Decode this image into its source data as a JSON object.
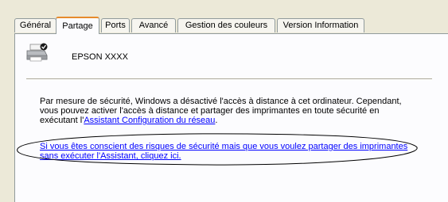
{
  "tabs": [
    {
      "label": "Général"
    },
    {
      "label": "Partage",
      "active": true
    },
    {
      "label": "Ports"
    },
    {
      "label": "Avancé"
    },
    {
      "label": "Gestion des couleurs"
    },
    {
      "label": "Version Information"
    }
  ],
  "printer": {
    "icon": "shared-printer-icon",
    "name": "EPSON XXXX"
  },
  "message": {
    "text": "Par mesure de sécurité, Windows a désactivé l'accès à distance à cet ordinateur. Cependant, vous pouvez activer l'accès à distance et partager des imprimantes en toute sécurité en exécutant l'",
    "link": "Assistant Configuration du réseau",
    "suffix": "."
  },
  "share_link": "Si vous êtes conscient des risques de sécurité mais que vous voulez partager des imprimantes sans exécuter l'Assistant, cliquez ici.",
  "colors": {
    "link": "#0000ff",
    "tab_border": "#919b9c",
    "active_tab_accent": "#e68b2c",
    "dialog_background": "#ece9d8",
    "panel_background": "#fcfcfe"
  }
}
